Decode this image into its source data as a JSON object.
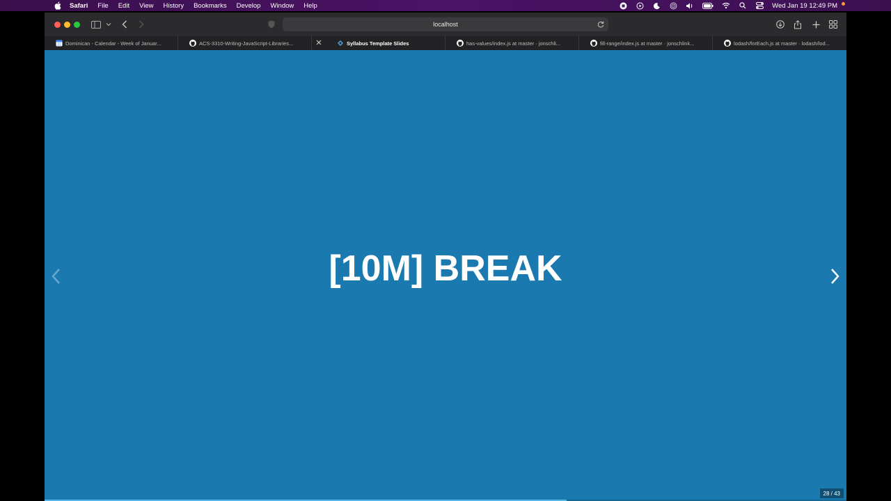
{
  "menubar": {
    "items": [
      "Safari",
      "File",
      "Edit",
      "View",
      "History",
      "Bookmarks",
      "Develop",
      "Window",
      "Help"
    ],
    "clock": "Wed Jan 19  12:49 PM"
  },
  "toolbar": {
    "address": "localhost"
  },
  "tabs": [
    {
      "label": "Dominican - Calendar - Week of Januar...",
      "icon": "calendar-icon"
    },
    {
      "label": "ACS-3310-Writing-JavaScript-Libraries...",
      "icon": "github-icon"
    },
    {
      "label": "Syllabus Template Slides",
      "icon": "slides-icon",
      "active": true
    },
    {
      "label": "has-values/index.js at master · jonschli...",
      "icon": "github-icon"
    },
    {
      "label": "fill-range/index.js at master · jonschlink...",
      "icon": "github-icon"
    },
    {
      "label": "lodash/forEach.js at master · lodash/lod...",
      "icon": "github-icon"
    }
  ],
  "slide": {
    "title": "[10M] BREAK",
    "counter": "28 / 43",
    "current": 28,
    "total": 43,
    "background": "#1a7ab0"
  }
}
